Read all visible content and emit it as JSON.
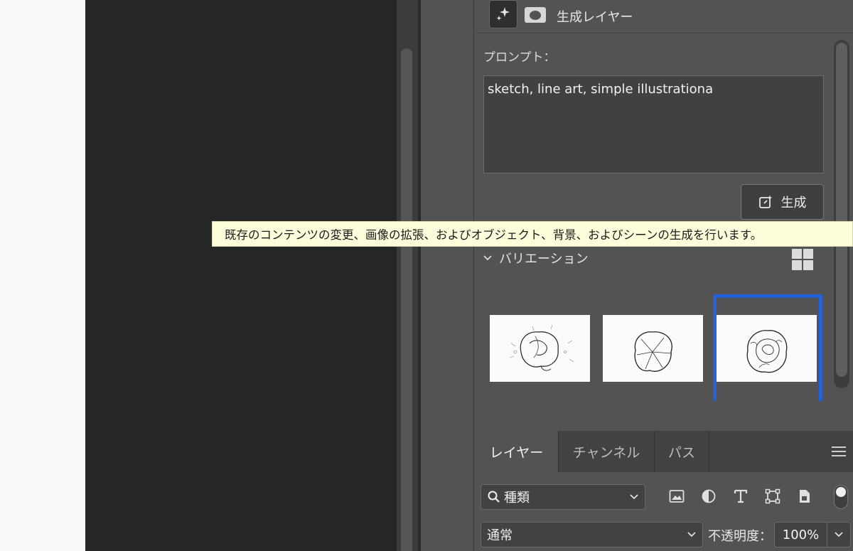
{
  "properties": {
    "layer_type": "生成レイヤー",
    "prompt_label": "プロンプト：",
    "prompt_text": "sketch, line art, simple illustrationa",
    "generate_label": "生成",
    "variations_label": "バリエーション"
  },
  "tooltip": "既存のコンテンツの変更、画像の拡張、およびオブジェクト、背景、およびシーンの生成を行います。",
  "layers_panel": {
    "tabs": [
      "レイヤー",
      "チャンネル",
      "パス"
    ],
    "active_tab": "レイヤー",
    "filter_value": "種類",
    "blend_mode": "通常",
    "opacity_label": "不透明度：",
    "opacity_value": "100%"
  },
  "colors": {
    "selection": "#2261d6",
    "tooltip_bg": "#fdfddb",
    "panel_bg": "#535353",
    "canvas_bg": "#262626"
  }
}
